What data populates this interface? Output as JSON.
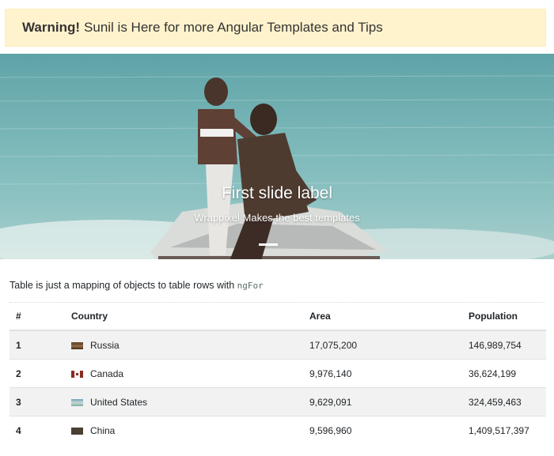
{
  "alert": {
    "strong": "Warning!",
    "text": "Sunil is Here for more Angular Templates and Tips"
  },
  "carousel": {
    "title": "First slide label",
    "subtitle": "Wrappixel Makes the best templates"
  },
  "intro": {
    "text": "Table is just a mapping of objects to table rows with",
    "code": "ngFor"
  },
  "table": {
    "headers": [
      "#",
      "Country",
      "Area",
      "Population"
    ],
    "rows": [
      {
        "num": "1",
        "country": "Russia",
        "area": "17,075,200",
        "population": "146,989,754",
        "flag": "flag-russia-icon"
      },
      {
        "num": "2",
        "country": "Canada",
        "area": "9,976,140",
        "population": "36,624,199",
        "flag": "flag-canada-icon"
      },
      {
        "num": "3",
        "country": "United States",
        "area": "9,629,091",
        "population": "324,459,463",
        "flag": "flag-us-icon"
      },
      {
        "num": "4",
        "country": "China",
        "area": "9,596,960",
        "population": "1,409,517,397",
        "flag": "flag-china-icon"
      }
    ]
  }
}
